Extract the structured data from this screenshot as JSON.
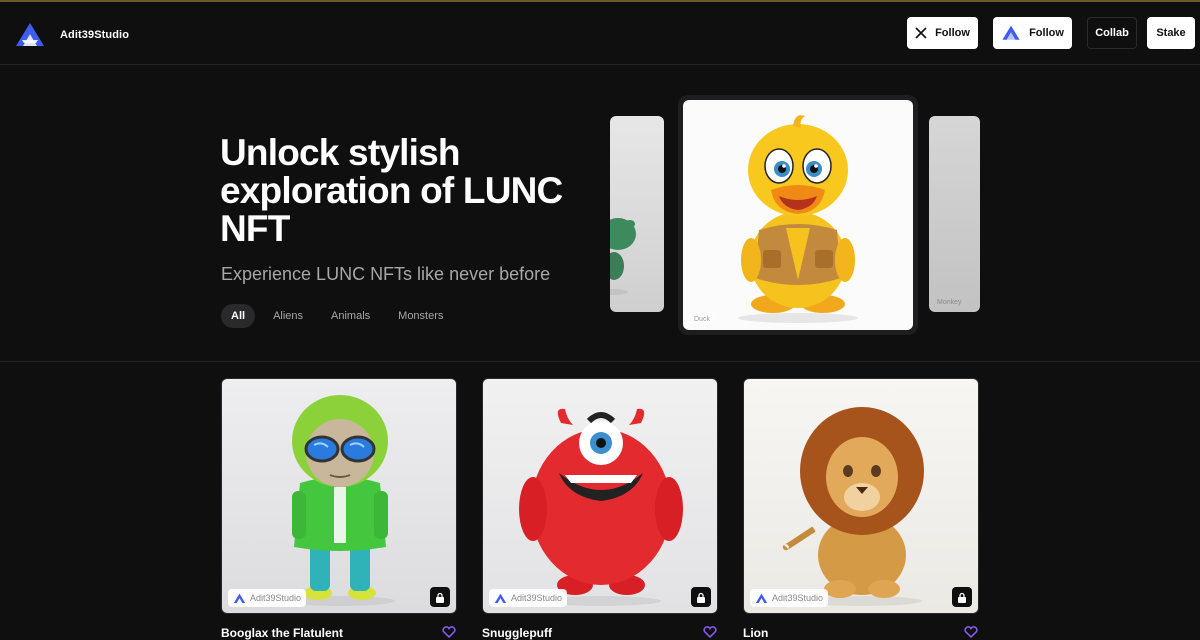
{
  "brand": {
    "name": "Adit39Studio"
  },
  "header": {
    "follow_x_label": "Follow",
    "follow_studio_label": "Follow",
    "collab_label": "Collab",
    "stake_label": "Stake"
  },
  "hero": {
    "title": "Unlock stylish exploration of LUNC NFT",
    "subtitle": "Experience LUNC NFTs like never before",
    "filters": [
      "All",
      "Aliens",
      "Animals",
      "Monsters"
    ],
    "active_filter": "All"
  },
  "carousel": {
    "main_label": "Duck",
    "right_label": "Monkey"
  },
  "nfts": [
    {
      "name": "Booglax the Flatulent",
      "creator": "Adit39Studio"
    },
    {
      "name": "Snugglepuff",
      "creator": "Adit39Studio"
    },
    {
      "name": "Lion",
      "creator": "Adit39Studio"
    }
  ],
  "colors": {
    "background": "#0f0f10",
    "accent_logo": "#3f5cf0",
    "heart": "#8b5cf6",
    "subtitle": "#a7a7ab"
  },
  "icons": [
    "x-logo-icon",
    "studio-logo-icon",
    "lock-icon",
    "heart-icon"
  ]
}
